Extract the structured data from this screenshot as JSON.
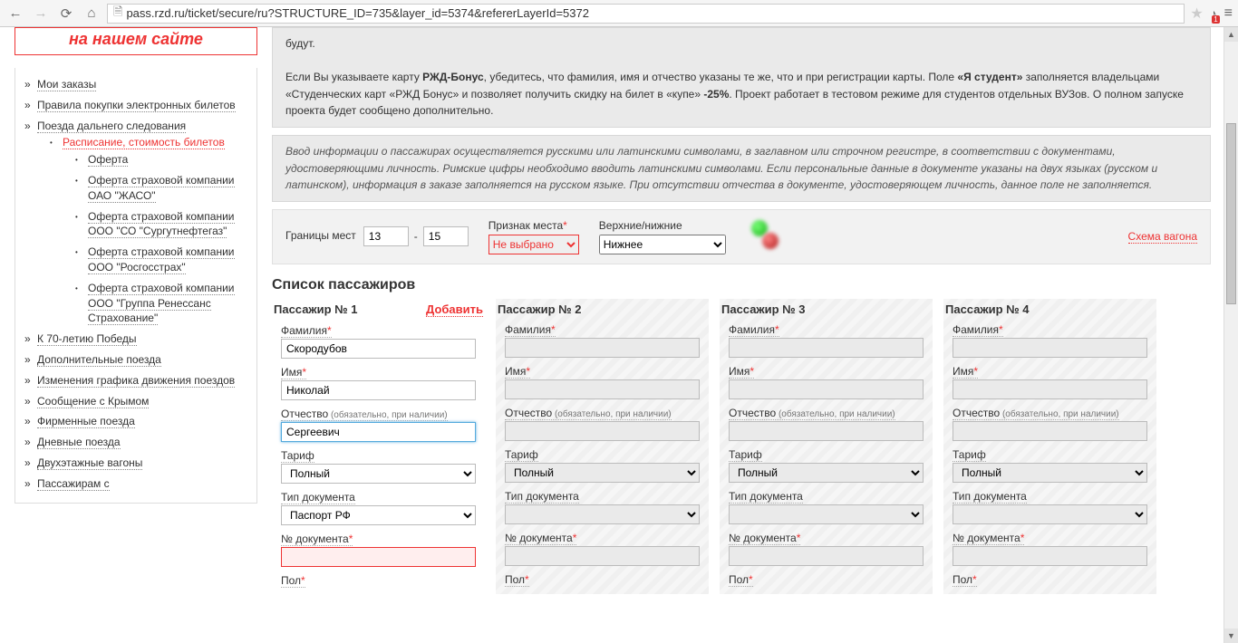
{
  "browser": {
    "url": "pass.rzd.ru/ticket/secure/ru?STRUCTURE_ID=735&layer_id=5374&refererLayerId=5372"
  },
  "promo": "на нашем сайте",
  "sidebar": {
    "items": [
      {
        "label": "Мои заказы"
      },
      {
        "label": "Правила покупки электронных билетов"
      },
      {
        "label": "Поезда дальнего следования",
        "sub": [
          {
            "label": "Расписание, стоимость билетов",
            "red": true,
            "sub": [
              {
                "label": "Оферта"
              },
              {
                "label": "Оферта страховой компании ОАО \"ЖАСО\""
              },
              {
                "label": "Оферта страховой компании ООО \"СО \"Сургутнефтегаз\""
              },
              {
                "label": "Оферта страховой компании ООО \"Росгосстрах\""
              },
              {
                "label": "Оферта страховой компании ООО \"Группа Ренессанс Страхование\""
              }
            ]
          }
        ]
      },
      {
        "label": "К 70-летию Победы"
      },
      {
        "label": "Дополнительные поезда"
      },
      {
        "label": "Изменения графика движения поездов"
      },
      {
        "label": "Сообщение с Крымом"
      },
      {
        "label": "Фирменные поезда"
      },
      {
        "label": "Дневные поезда"
      },
      {
        "label": "Двухэтажные вагоны"
      },
      {
        "label": "Пассажирам с"
      }
    ]
  },
  "info1_tail": "будут.",
  "info2_pre": "Если Вы указываете карту ",
  "info2_b1": "РЖД-Бонус",
  "info2_mid": ", убедитесь, что фамилия, имя и отчество указаны те же, что и при регистрации карты. Поле ",
  "info2_b2": "«Я студент»",
  "info2_post": " заполняется владельцами «Студенческих карт «РЖД Бонус» и позволяет получить скидку на билет в «купе» ",
  "info2_b3": "-25%",
  "info2_end": ". Проект работает в тестовом режиме для студентов отдельных ВУЗов. О полном запуске проекта будет сообщено дополнительно.",
  "info3": "Ввод информации о пассажирах осуществляется русскими или латинскими символами, в заглавном или строчном регистре, в соответствии с документами, удостоверяющими личность. Римские цифры необходимо вводить латинскими символами. Если персональные данные в документе указаны на двух языках (русском и латинском), информация в заказе заполняется на русском языке. При отсутствии отчества в документе, удостоверяющем личность, данное поле не заполняется.",
  "seat": {
    "label_range": "Границы мест",
    "from": "13",
    "to": "15",
    "label_sign": "Признак места",
    "sign_selected": "Не выбрано",
    "label_level": "Верхние/нижние",
    "level_selected": "Нижнее",
    "wagon": "Схема вагона"
  },
  "list_title": "Список пассажиров",
  "add_label": "Добавить",
  "labels": {
    "surname": "Фамилия",
    "name": "Имя",
    "patronymic": "Отчество",
    "patronymic_hint": "(обязательно, при наличии)",
    "tariff": "Тариф",
    "doctype": "Тип документа",
    "docnum": "№ документа",
    "gender": "Пол"
  },
  "defaults": {
    "tariff": "Полный",
    "doctype": "Паспорт РФ"
  },
  "passengers": [
    {
      "title": "Пассажир № 1",
      "surname": "Скородубов",
      "name": "Николай",
      "patronymic": "Сергеевич",
      "add": true
    },
    {
      "title": "Пассажир № 2"
    },
    {
      "title": "Пассажир № 3"
    },
    {
      "title": "Пассажир № 4"
    }
  ]
}
